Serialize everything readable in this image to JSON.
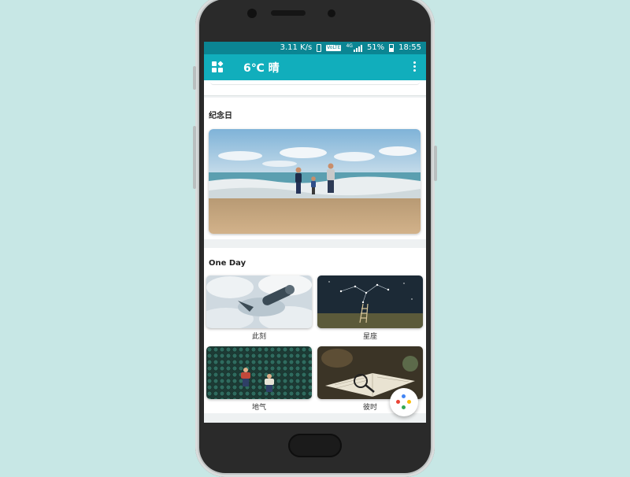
{
  "status_bar": {
    "speed": "3.11 K/s",
    "network_badge": "VoLTE",
    "network_type": "4G",
    "battery": "51%",
    "time": "18:55"
  },
  "app_bar": {
    "title": "6℃ 晴",
    "menu_icon": "dashboard-grid-icon",
    "more_icon": "more-vert-icon"
  },
  "anniversary": {
    "title": "纪念日",
    "image": "family-at-beach-photo"
  },
  "one_day": {
    "title": "One Day",
    "tiles": [
      {
        "label": "此刻",
        "image": "surreal-clouds-telescope"
      },
      {
        "label": "星座",
        "image": "night-sky-constellation-ladder"
      },
      {
        "label": "地气",
        "image": "kids-lying-on-green-pattern"
      },
      {
        "label": "彼时",
        "image": "book-magnifier-still-life"
      }
    ]
  },
  "fab": {
    "icon": "google-assistant-dots-icon"
  },
  "colors": {
    "background": "#c7e7e5",
    "status_bar": "#0b8593",
    "app_bar": "#11aebc"
  }
}
